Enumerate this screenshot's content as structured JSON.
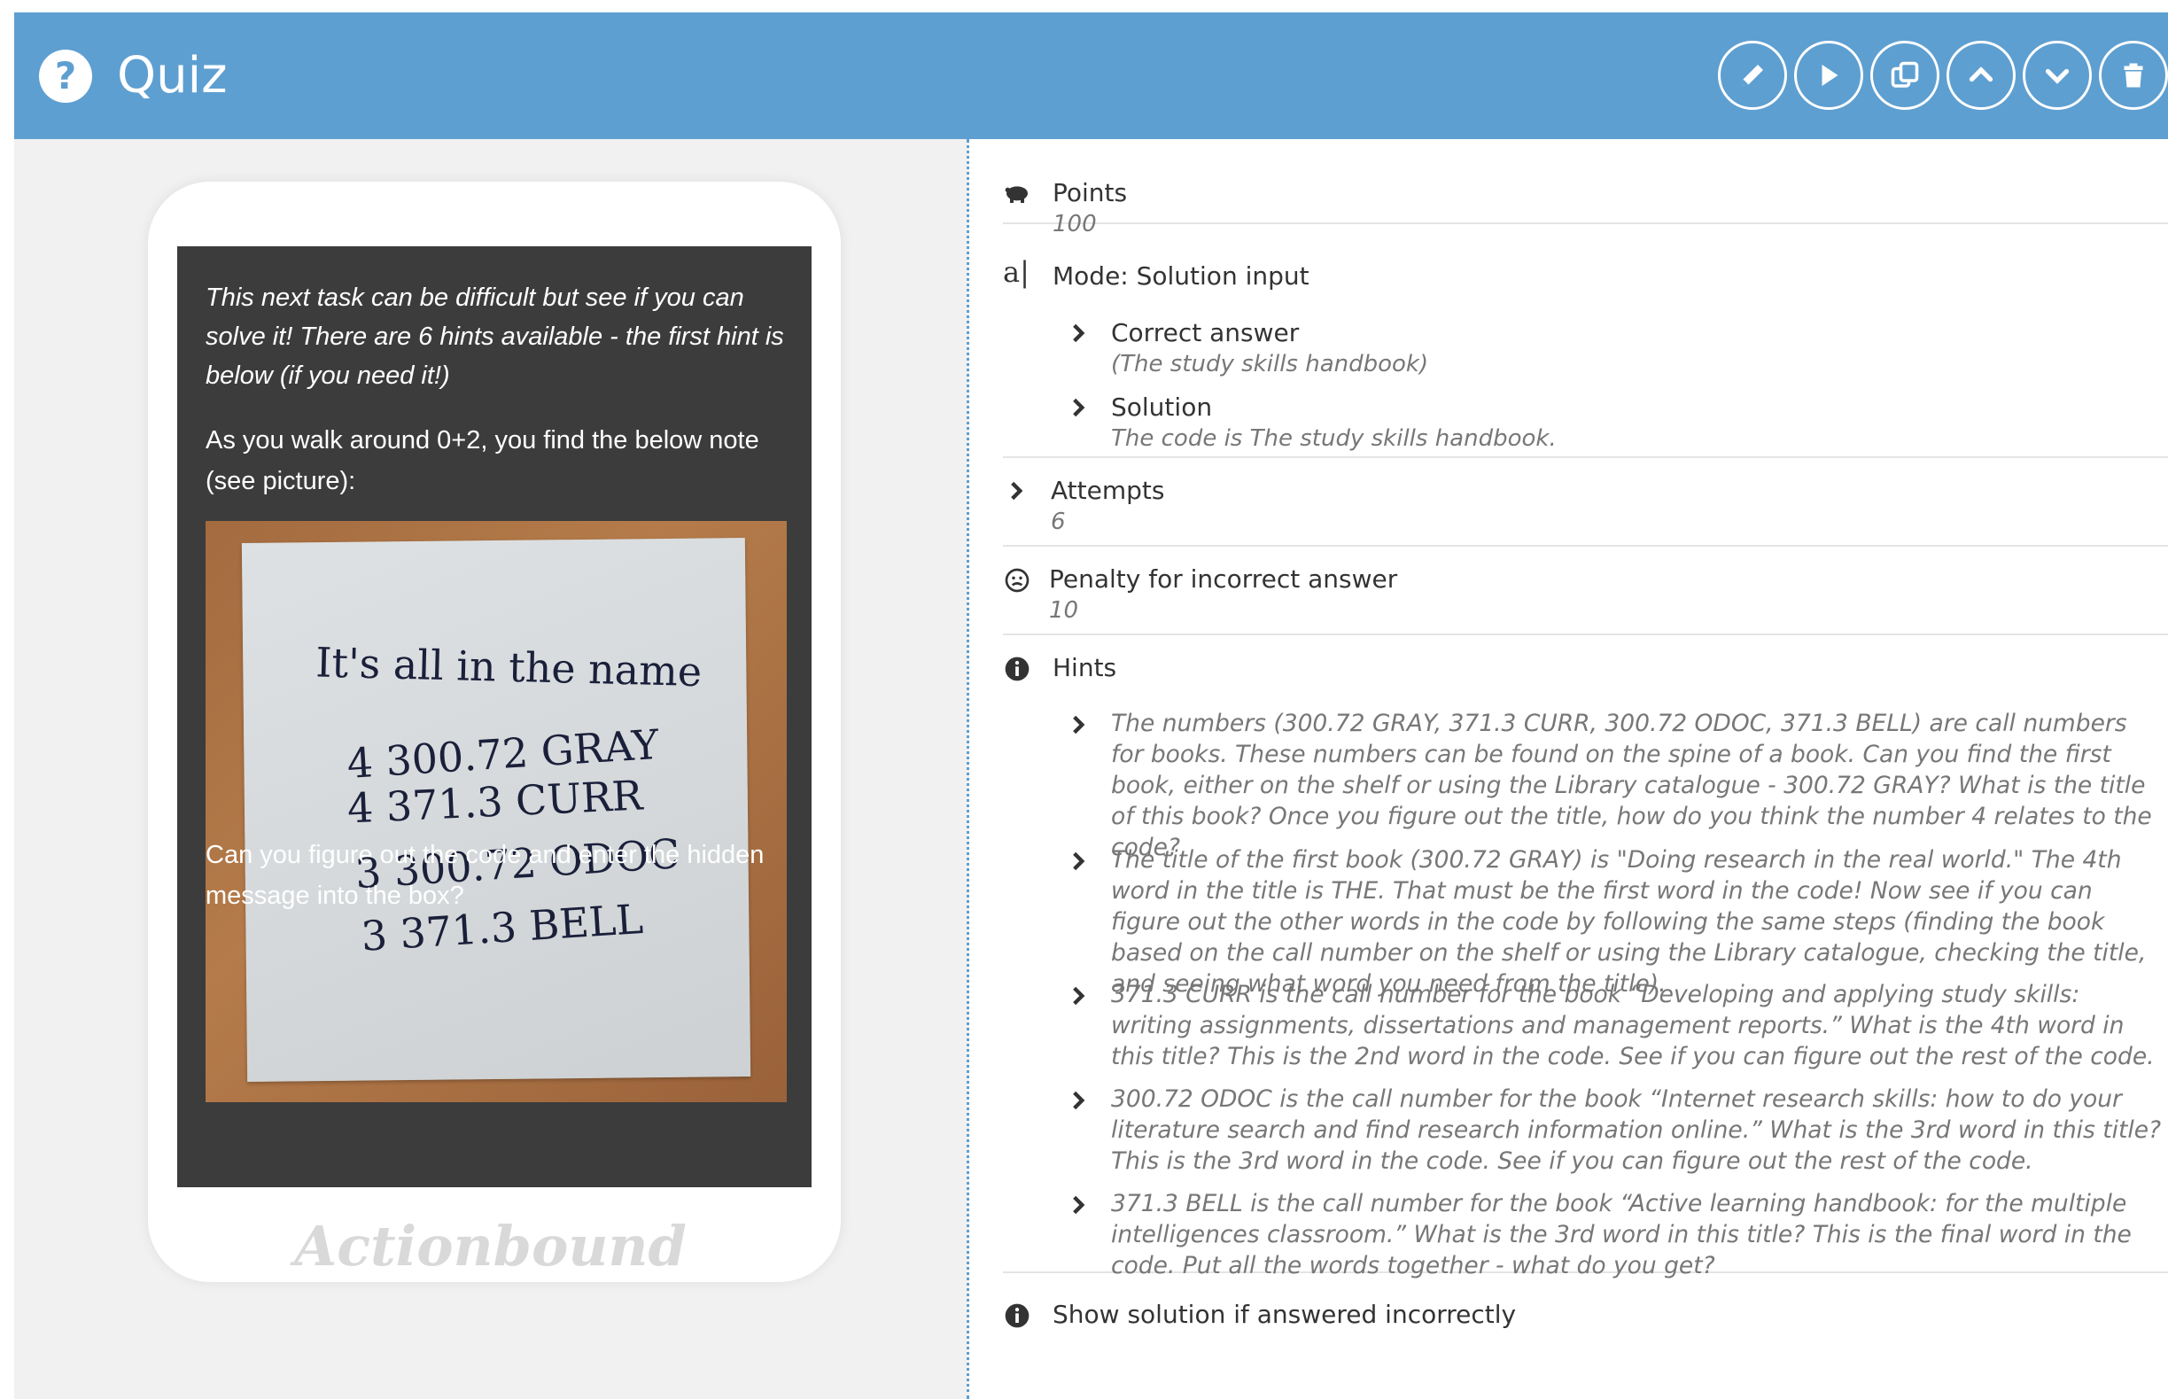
{
  "header": {
    "title": "Quiz",
    "buttons": [
      "edit",
      "play",
      "duplicate",
      "move-up",
      "move-down",
      "delete"
    ]
  },
  "preview": {
    "intro": "This next task can be difficult but see if you can solve it! There are 6 hints available - the first hint is below (if you need it!)",
    "walk": "As you walk around 0+2, you find the below note (see picture):",
    "note": {
      "heading": "It's all in the name",
      "lines": [
        "4  300.72 GRAY",
        "4  371.3 CURR",
        "3  300.72 ODOC",
        "3  371.3 BELL"
      ]
    },
    "question": "Can you figure out the code and enter the hidden message into the box?",
    "brand": "Actionbound"
  },
  "details": {
    "points": {
      "label": "Points",
      "value": "100"
    },
    "mode": {
      "label": "Mode: Solution input",
      "correct_answer": {
        "label": "Correct answer",
        "value": "(The study skills handbook)"
      },
      "solution": {
        "label": "Solution",
        "value": "The code is The study skills handbook."
      }
    },
    "attempts": {
      "label": "Attempts",
      "value": "6"
    },
    "penalty": {
      "label": "Penalty for incorrect answer",
      "value": "10"
    },
    "hints": {
      "label": "Hints",
      "items": [
        "The numbers (300.72 GRAY, 371.3 CURR, 300.72 ODOC, 371.3 BELL) are call numbers for books. These numbers can be found on the spine of a book. Can you find the first book, either on the shelf or using the Library catalogue - 300.72 GRAY? What is the title of this book? Once you figure out the title, how do you think the number 4 relates to the code?",
        "The title of the first book (300.72 GRAY) is \"Doing research in the real world.\" The 4th word in the title is THE. That must be the first word in the code! Now see if you can figure out the other words in the code by following the same steps (finding the book based on the call number on the shelf or using the Library catalogue, checking the title, and seeing what word you need from the title).",
        "371.3 CURR is the call number for the book “Developing and applying study skills: writing assignments, dissertations and management reports.” What is the 4th word in this title? This is the 2nd word in the code. See if you can figure out the rest of the code.",
        "300.72 ODOC is the call number for the book “Internet research skills: how to do your literature search and find research information online.” What is the 3rd word in this title? This is the 3rd word in the code. See if you can figure out the rest of the code.",
        "371.3 BELL is the call number for the book “Active learning handbook: for the multiple intelligences classroom.” What is the 3rd word in this title? This is the final word in the code. Put all the words together - what do you get?"
      ]
    },
    "show_solution": {
      "label": "Show solution if answered incorrectly"
    }
  }
}
